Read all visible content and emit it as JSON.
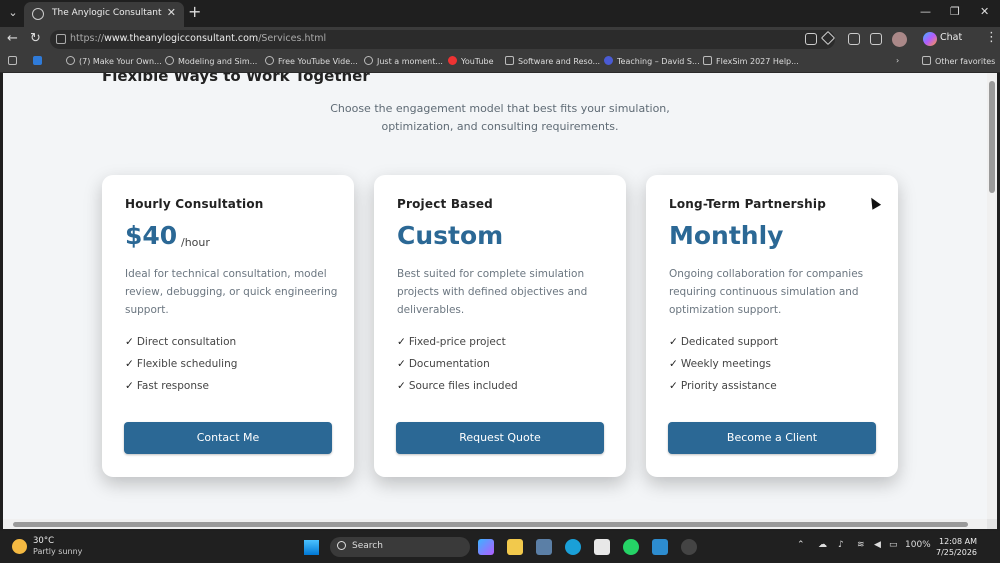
{
  "browser": {
    "tab_title": "The Anylogic Consultant",
    "url_prefix": "https://",
    "url_host": "www.theanylogicconsultant.com",
    "url_path": "/Services.html",
    "chat_label": "Chat",
    "bookmarks": [
      "(7) Make Your Own...",
      "Modeling and Sim...",
      "Free YouTube Vide...",
      "Just a moment...",
      "YouTube",
      "Software and Reso...",
      "Teaching – David S...",
      "FlexSim 2027 Help..."
    ],
    "other_favorites": "Other favorites"
  },
  "page": {
    "heading": "Flexible Ways to Work Together",
    "subtitle": "Choose the engagement model that best fits your simulation, optimization, and consulting requirements.",
    "cards": [
      {
        "title": "Hourly Consultation",
        "price": "$40",
        "price_unit": "/hour",
        "description": "Ideal for technical consultation, model review, debugging, or quick engineering support.",
        "features": [
          "Direct consultation",
          "Flexible scheduling",
          "Fast response"
        ],
        "button": "Contact Me"
      },
      {
        "title": "Project Based",
        "price": "Custom",
        "price_unit": "",
        "description": "Best suited for complete simulation projects with defined objectives and deliverables.",
        "features": [
          "Fixed-price project",
          "Documentation",
          "Source files included"
        ],
        "button": "Request Quote"
      },
      {
        "title": "Long-Term Partnership",
        "price": "Monthly",
        "price_unit": "",
        "description": "Ongoing collaboration for companies requiring continuous simulation and optimization support.",
        "features": [
          "Dedicated support",
          "Weekly meetings",
          "Priority assistance"
        ],
        "button": "Become a Client"
      }
    ],
    "check_mark": "✓",
    "colors": {
      "accent": "#2b6895",
      "background": "#f3f5f7"
    }
  },
  "taskbar": {
    "temperature": "30°C",
    "condition": "Partly sunny",
    "search_label": "Search",
    "battery": "100%",
    "time": "12:08 AM",
    "date": "7/25/2026"
  }
}
